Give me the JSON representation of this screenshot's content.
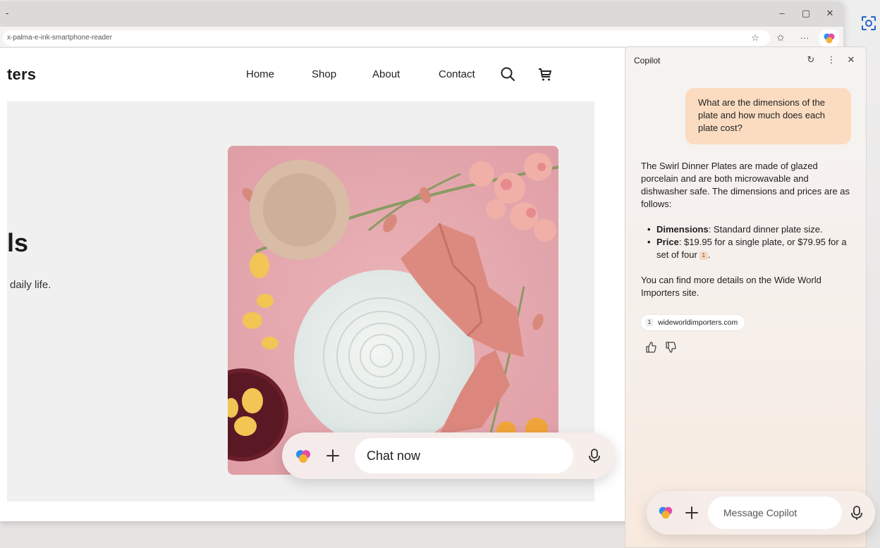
{
  "browser": {
    "tab_title": "-",
    "url": "x-palma-e-ink-smartphone-reader",
    "window_controls": [
      "minimize-icon",
      "maximize-icon",
      "close-icon"
    ],
    "toolbar_icons": [
      "favorite-star-icon",
      "favorites-icon",
      "more-icon",
      "copilot-icon"
    ]
  },
  "site": {
    "logo": "ters",
    "nav": [
      "Home",
      "Shop",
      "About",
      "Contact"
    ],
    "nav_icons": [
      "search-icon",
      "cart-icon"
    ],
    "hero_title": "ls",
    "hero_subtitle": "daily life."
  },
  "page_chatbar": {
    "placeholder": "Chat now",
    "icons": [
      "copilot-icon",
      "plus-icon",
      "microphone-icon"
    ]
  },
  "copilot": {
    "title": "Copilot",
    "header_icons": [
      "refresh-icon",
      "more-icon",
      "close-icon"
    ],
    "user_message": "What are the dimensions of the plate and how much does each plate cost?",
    "answer_intro": "The Swirl Dinner Plates are made of glazed porcelain and are both microwavable and dishwasher safe. The dimensions and prices are as follows:",
    "bullets": [
      {
        "label": "Dimensions",
        "text": ": Standard dinner plate size."
      },
      {
        "label": "Price",
        "text": ": $19.95 for a single plate, or $79.95 for a set of four",
        "citation": "1"
      }
    ],
    "answer_outro": "You can find more details on the Wide World Importers site.",
    "source": {
      "num": "1",
      "domain": "wideworldimporters.com"
    },
    "feedback_icons": [
      "thumbs-up-icon",
      "thumbs-down-icon"
    ],
    "composer_placeholder": "Message Copilot",
    "composer_icons": [
      "copilot-icon",
      "plus-icon",
      "microphone-icon"
    ]
  },
  "colors": {
    "user_bubble": "#fbdcc1",
    "panel_bg": "#f6f3f2",
    "photo_pink": "#e6a9b0"
  }
}
